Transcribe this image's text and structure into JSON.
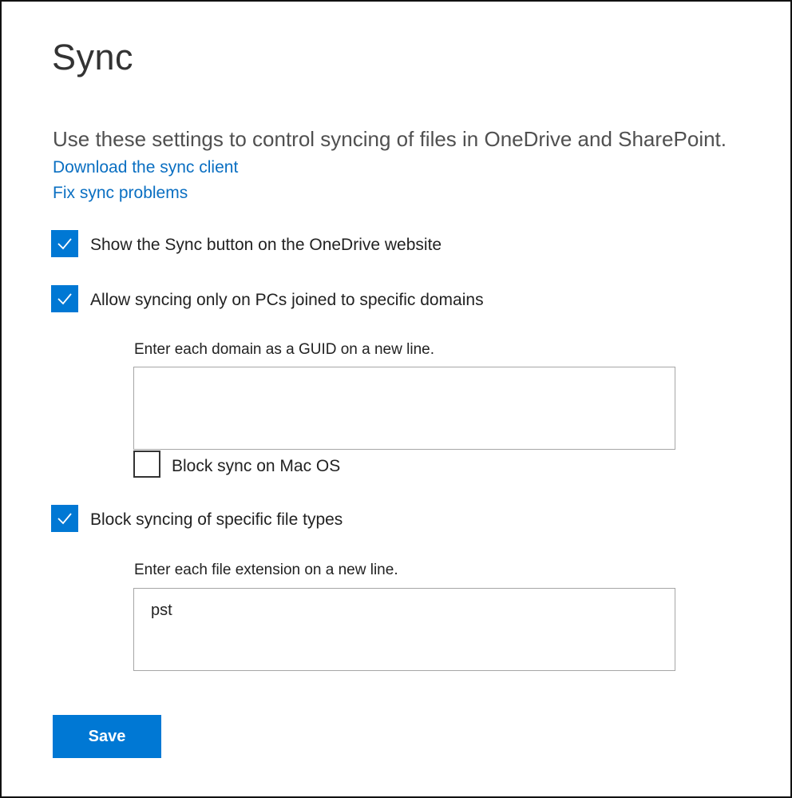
{
  "page": {
    "title": "Sync",
    "description": "Use these settings to control syncing of files in OneDrive and SharePoint.",
    "links": {
      "download": "Download the sync client",
      "fix": "Fix sync problems"
    }
  },
  "settings": {
    "show_sync_button": {
      "label": "Show the Sync button on the OneDrive website",
      "checked": true
    },
    "allow_domains": {
      "label": "Allow syncing only on PCs joined to specific domains",
      "checked": true,
      "hint": "Enter each domain as a GUID on a new line.",
      "value": "",
      "block_mac": {
        "label": "Block sync on Mac OS",
        "checked": false
      }
    },
    "block_file_types": {
      "label": "Block syncing of specific file types",
      "checked": true,
      "hint": "Enter each file extension on a new line.",
      "value": "pst"
    }
  },
  "actions": {
    "save_label": "Save"
  },
  "colors": {
    "accent": "#0078d4",
    "link": "#0a6fc2",
    "border": "#a6a6a6"
  },
  "icons": {
    "check": "check-icon"
  }
}
